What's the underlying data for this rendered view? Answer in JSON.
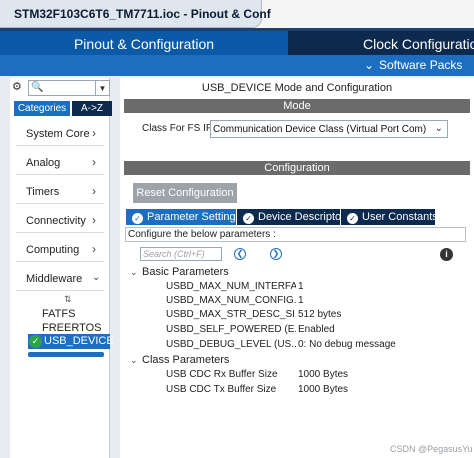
{
  "window": {
    "title": "STM32F103C6T6_TM7711.ioc - Pinout & Conf"
  },
  "main_tabs": {
    "pinout": "Pinout & Configuration",
    "clock": "Clock Configuration"
  },
  "software_packs": "Software Packs",
  "categories_panel": {
    "tabs": [
      "Categories",
      "A->Z"
    ],
    "items": [
      "System Core",
      "Analog",
      "Timers",
      "Connectivity",
      "Computing",
      "Middleware"
    ],
    "middleware_items": [
      "FATFS",
      "FREERTOS"
    ],
    "selected_item": "USB_DEVICE"
  },
  "config_panel": {
    "title": "USB_DEVICE Mode and Configuration",
    "mode_header": "Mode",
    "mode_label": "Class For FS IP",
    "mode_value": "Communication Device Class (Virtual Port Com)",
    "configuration_header": "Configuration",
    "reset_button": "Reset Configuration",
    "param_tabs": [
      "Parameter Settings",
      "Device Descriptor",
      "User Constants"
    ],
    "configure_text": "Configure the below parameters :",
    "search_placeholder": "Search (Ctrl+F)",
    "groups": [
      {
        "name": "Basic Parameters",
        "params": [
          {
            "name": "USBD_MAX_NUM_INTERFA...",
            "value": "1"
          },
          {
            "name": "USBD_MAX_NUM_CONFIG...",
            "value": "1"
          },
          {
            "name": "USBD_MAX_STR_DESC_SI...",
            "value": "512 bytes"
          },
          {
            "name": "USBD_SELF_POWERED (E...",
            "value": "Enabled"
          },
          {
            "name": "USBD_DEBUG_LEVEL (US...",
            "value": "0: No debug message"
          }
        ]
      },
      {
        "name": "Class Parameters",
        "params": [
          {
            "name": "USB CDC Rx Buffer Size",
            "value": "1000 Bytes"
          },
          {
            "name": "USB CDC Tx Buffer Size",
            "value": "1000 Bytes"
          }
        ]
      }
    ]
  },
  "watermark": "CSDN @PegasusYu",
  "colors": {
    "primary_blue": "#1c6fc0",
    "dark_navy": "#0c2a4d",
    "header_gray": "#6b6b6b",
    "ok_green": "#2ca44a"
  }
}
